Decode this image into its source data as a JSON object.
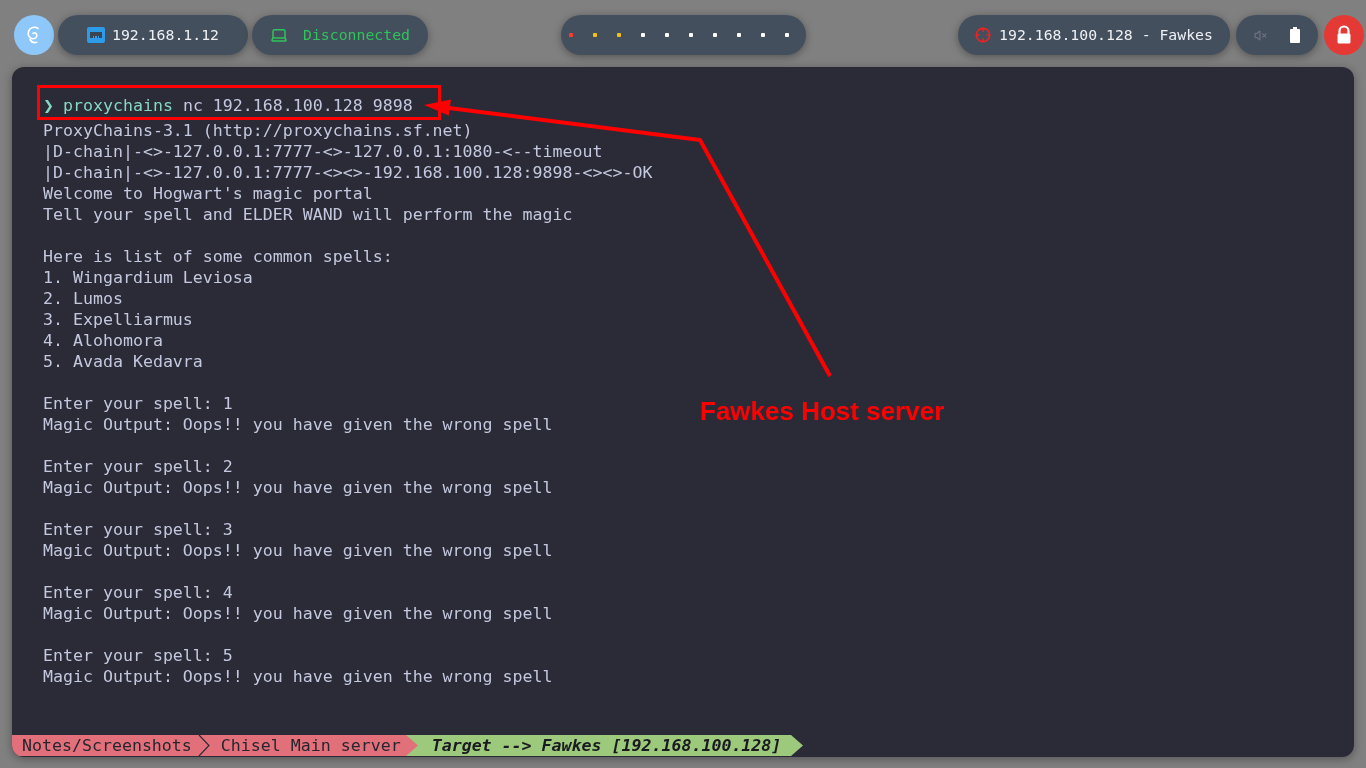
{
  "top_bar": {
    "ip_address": "192.168.1.12",
    "vpn_status": "Disconnected",
    "workspaces": [
      {
        "color": "#ff3b30"
      },
      {
        "color": "#f5c211"
      },
      {
        "color": "#f5c211"
      },
      {
        "color": "#ffffff"
      },
      {
        "color": "#ffffff"
      },
      {
        "color": "#ffffff"
      },
      {
        "color": "#ffffff"
      },
      {
        "color": "#ffffff"
      },
      {
        "color": "#ffffff"
      },
      {
        "color": "#ffffff"
      }
    ],
    "target": "192.168.100.128 - Fawkes"
  },
  "terminal": {
    "prompt_symbol": "❯",
    "command": {
      "program": "proxychains",
      "args": "nc 192.168.100.128 9898"
    },
    "output_blocks": [
      [
        "ProxyChains-3.1 (http://proxychains.sf.net)",
        "|D-chain|-<>-127.0.0.1:7777-<>-127.0.0.1:1080-<--timeout",
        "|D-chain|-<>-127.0.0.1:7777-<><>-192.168.100.128:9898-<><>-OK",
        "Welcome to Hogwart's magic portal",
        "Tell your spell and ELDER WAND will perform the magic"
      ],
      [
        "Here is list of some common spells:",
        "1. Wingardium Leviosa",
        "2. Lumos",
        "3. Expelliarmus",
        "4. Alohomora",
        "5. Avada Kedavra"
      ],
      [
        "Enter your spell: 1",
        "Magic Output: Oops!! you have given the wrong spell"
      ],
      [
        "Enter your spell: 2",
        "Magic Output: Oops!! you have given the wrong spell"
      ],
      [
        "Enter your spell: 3",
        "Magic Output: Oops!! you have given the wrong spell"
      ],
      [
        "Enter your spell: 4",
        "Magic Output: Oops!! you have given the wrong spell"
      ],
      [
        "Enter your spell: 5",
        "Magic Output: Oops!! you have given the wrong spell"
      ]
    ]
  },
  "status_line": {
    "segments": [
      {
        "kind": "path",
        "text": "Notes/Screenshots"
      },
      {
        "kind": "path",
        "text": "Chisel Main server"
      },
      {
        "kind": "target",
        "text": "Target --> Fawkes [192.168.100.128]"
      }
    ]
  },
  "annotation": {
    "label": "Fawkes Host server"
  }
}
